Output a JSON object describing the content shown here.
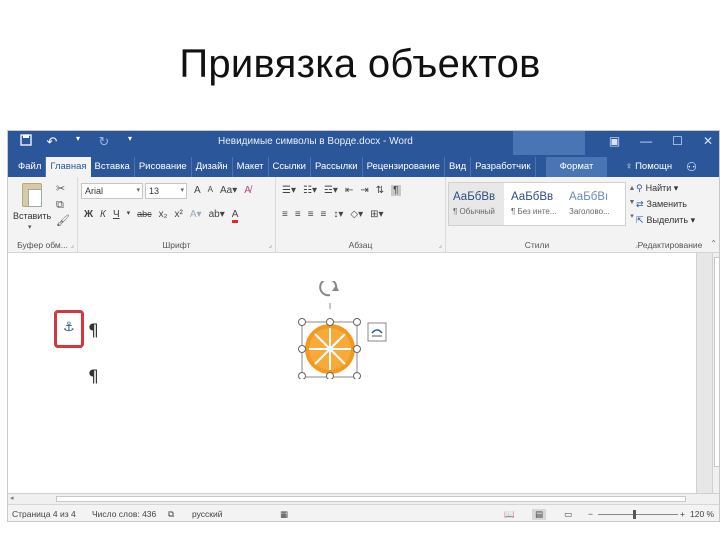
{
  "slide": {
    "title": "Привязка объектов"
  },
  "window": {
    "document_title": "Невидимые символы в Ворде.docx  -  Word",
    "qat": {
      "save_icon": "save-icon",
      "undo_icon": "undo-icon",
      "redo_icon": "redo-icon"
    }
  },
  "tabs": [
    {
      "label": "Файл"
    },
    {
      "label": "Главная",
      "active": true
    },
    {
      "label": "Вставка"
    },
    {
      "label": "Рисование"
    },
    {
      "label": "Дизайн"
    },
    {
      "label": "Макет"
    },
    {
      "label": "Ссылки"
    },
    {
      "label": "Рассылки"
    },
    {
      "label": "Рецензирование"
    },
    {
      "label": "Вид"
    },
    {
      "label": "Разработчик"
    }
  ],
  "context_tab": {
    "label": "Формат"
  },
  "help": {
    "label": "Помощн"
  },
  "ribbon": {
    "clipboard": {
      "paste_label": "Вставить",
      "group_label": "Буфер обм..."
    },
    "font": {
      "font_name": "Arial",
      "font_size": "13",
      "group_label": "Шрифт",
      "bold": "Ж",
      "italic": "К",
      "underline": "Ч",
      "strike": "abc",
      "subscript": "x₂",
      "superscript": "x²",
      "grow": "A",
      "shrink": "A",
      "font_color": "A"
    },
    "paragraph": {
      "group_label": "Абзац",
      "show_marks": "¶"
    },
    "styles": {
      "group_label": "Стили",
      "items": [
        {
          "sample": "АаБбВв",
          "name": "¶ Обычный"
        },
        {
          "sample": "АаБбВв",
          "name": "¶ Без инте..."
        },
        {
          "sample": "АаБбВı",
          "name": "Заголово..."
        }
      ]
    },
    "editing": {
      "find": "Найти",
      "replace": "Заменить",
      "select": "Выделить",
      "group_label": "Редактирование"
    }
  },
  "document": {
    "pilcrow": "¶",
    "anchor_icon": "anchor-icon",
    "orange_icon": "orange-slice-icon"
  },
  "status": {
    "page": "Страница 4 из 4",
    "words": "Число слов: 436",
    "language": "русский",
    "zoom": "120 %"
  },
  "colors": {
    "accent": "#2b579a",
    "highlight": "#d2383d",
    "orange": "#f29a1f"
  }
}
